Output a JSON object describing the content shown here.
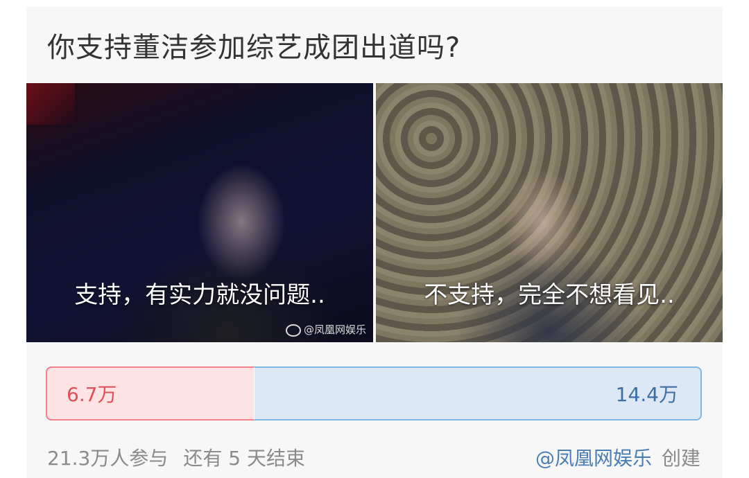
{
  "poll": {
    "title": "你支持董洁参加综艺成团出道吗?",
    "options": [
      {
        "label": "支持，有实力就没问题..",
        "count_label": "6.7万",
        "votes_wan": 6.7
      },
      {
        "label": "不支持，完全不想看见..",
        "count_label": "14.4万",
        "votes_wan": 14.4
      }
    ],
    "watermark": "@凤凰网娱乐",
    "participants": "21.3万人参与",
    "remaining": "还有 5 天结束",
    "author": "@凤凰网娱乐",
    "created": "创建"
  },
  "colors": {
    "support": "#e0505a",
    "oppose": "#3c6ea4"
  }
}
